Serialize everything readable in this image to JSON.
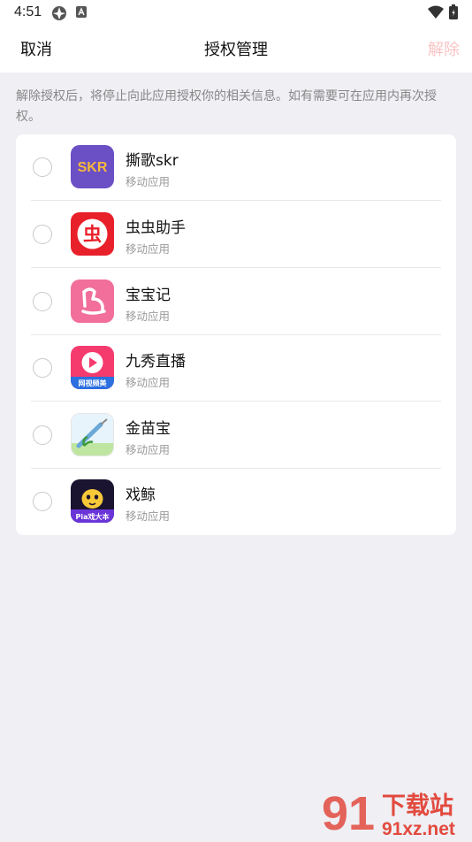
{
  "status_bar": {
    "time": "4:51"
  },
  "header": {
    "cancel_label": "取消",
    "title": "授权管理",
    "remove_label": "解除"
  },
  "notice": "解除授权后，将停止向此应用授权你的相关信息。如有需要可在应用内再次授权。",
  "apps": [
    {
      "name": "撕歌skr",
      "type": "移动应用",
      "icon": "skr-app-icon",
      "icon_text": "SKR"
    },
    {
      "name": "虫虫助手",
      "type": "移动应用",
      "icon": "chongchong-app-icon",
      "icon_text": "虫"
    },
    {
      "name": "宝宝记",
      "type": "移动应用",
      "icon": "baobaoji-app-icon"
    },
    {
      "name": "九秀直播",
      "type": "移动应用",
      "icon": "jiuxiu-app-icon",
      "icon_text": "网视频美"
    },
    {
      "name": "金苗宝",
      "type": "移动应用",
      "icon": "jinmiaobao-app-icon"
    },
    {
      "name": "戏鲸",
      "type": "移动应用",
      "icon": "xijing-app-icon",
      "icon_text": "Pia戏大本"
    }
  ],
  "watermark": {
    "logo_text": "91",
    "title": "下载站",
    "url": "91xz.net"
  },
  "colors": {
    "accent_disabled": "#f8c4c4",
    "page_bg": "#efeff4"
  }
}
